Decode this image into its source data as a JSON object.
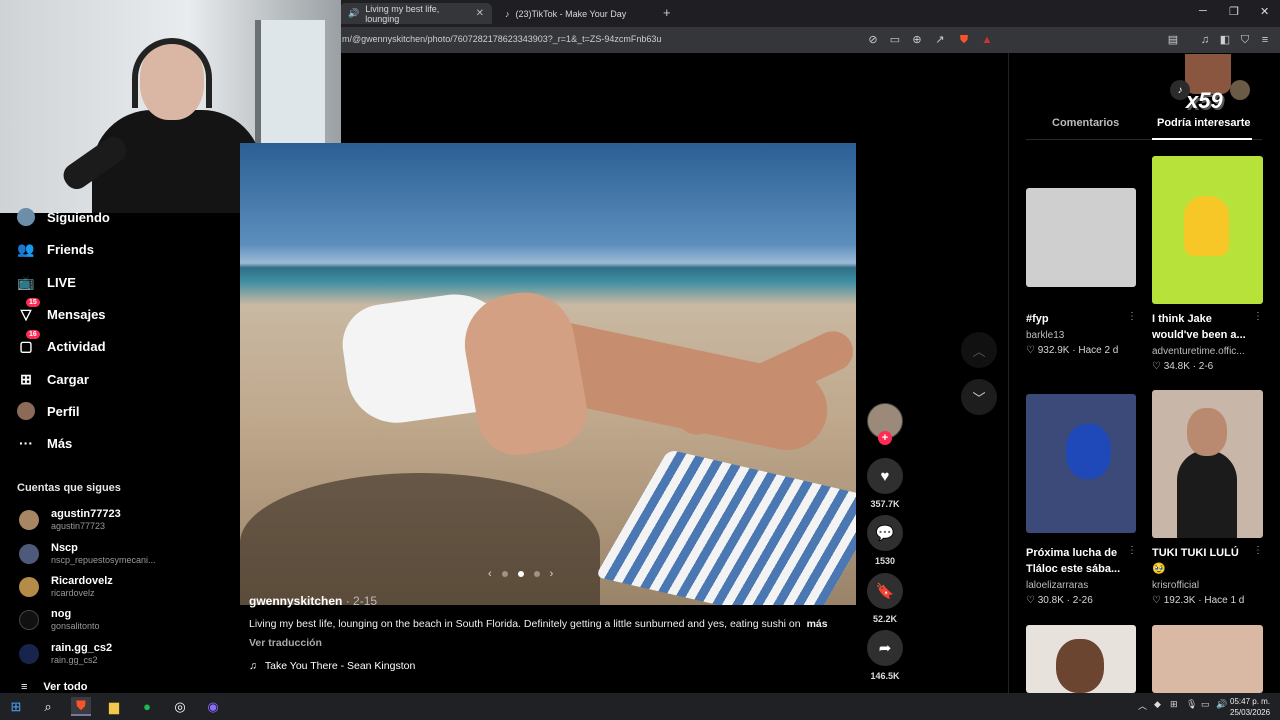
{
  "browser": {
    "tabs": [
      {
        "title": "Living my best life, lounging",
        "active": true
      },
      {
        "title": "(23)TikTok - Make Your Day",
        "active": false
      }
    ],
    "url": "m/@gwennyskitchen/photo/7607282178623343903?_r=1&_t=ZS-94zcmFnb63u"
  },
  "sidebar": {
    "nav": [
      {
        "label": "Siguiendo",
        "icon": "following-avatar-icon"
      },
      {
        "label": "Friends",
        "icon": "friends-icon"
      },
      {
        "label": "LIVE",
        "icon": "live-icon"
      },
      {
        "label": "Mensajes",
        "icon": "messages-icon",
        "badge": "15"
      },
      {
        "label": "Actividad",
        "icon": "activity-icon",
        "badge": "16"
      },
      {
        "label": "Cargar",
        "icon": "upload-icon"
      },
      {
        "label": "Perfil",
        "icon": "profile-avatar-icon"
      },
      {
        "label": "Más",
        "icon": "more-icon"
      }
    ],
    "following_title": "Cuentas que sigues",
    "following": [
      {
        "name": "agustin77723",
        "handle": "agustin77723"
      },
      {
        "name": "Nscp",
        "handle": "nscp_repuestosymecani..."
      },
      {
        "name": "Ricardovelz",
        "handle": "ricardovelz"
      },
      {
        "name": "nog",
        "handle": "gonsalitonto"
      },
      {
        "name": "rain.gg_cs2",
        "handle": "rain.gg_cs2"
      }
    ],
    "see_all": "Ver todo"
  },
  "post": {
    "author": "gwennyskitchen",
    "date": "· 2-15",
    "caption": "Living my best life, lounging on the beach in South Florida. Definitely getting a little sunburned and yes, eating sushi on",
    "more": "más",
    "translate": "Ver traducción",
    "music": "Take You There - Sean Kingston",
    "likes": "357.7K",
    "comments": "1530",
    "saves": "52.2K",
    "shares": "146.5K"
  },
  "right_panel": {
    "tabs": [
      {
        "label": "Comentarios",
        "active": false
      },
      {
        "label": "Podría interesarte",
        "active": true
      }
    ],
    "overlay_text": "x59",
    "cards": [
      {
        "title": "#fyp",
        "author": "barkle13",
        "likes": "932.9K",
        "time": "Hace 2 d",
        "thumb_color": "#cfcfcf"
      },
      {
        "title": "I think Jake would've been a...",
        "author": "adventuretime.offic...",
        "likes": "34.8K",
        "time": "2-6",
        "thumb_color": "#b7e23a"
      },
      {
        "title": "Próxima lucha de Tláloc este sába...",
        "author": "laloelizarraras",
        "likes": "30.8K",
        "time": "2-26",
        "thumb_color": "#3b4a78"
      },
      {
        "title": "TUKI TUKI LULÚ 🥹",
        "author": "krisrofficial",
        "likes": "192.3K",
        "time": "Hace 1 d",
        "thumb_color": "#c8b7a8"
      },
      {
        "title": "",
        "author": "",
        "likes": "",
        "time": "",
        "thumb_color": "#e8e2dc"
      },
      {
        "title": "",
        "author": "",
        "likes": "",
        "time": "",
        "thumb_color": "#d9b9a3"
      }
    ]
  },
  "taskbar": {
    "time": "05:47 p. m.",
    "date": "25/03/2026"
  }
}
